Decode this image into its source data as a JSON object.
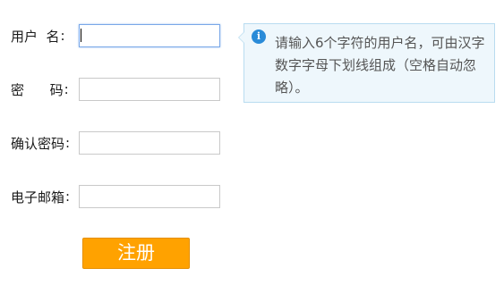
{
  "form": {
    "username": {
      "label": "用户  名",
      "colon": ":",
      "value": ""
    },
    "password": {
      "label": "密      码",
      "colon": ":",
      "value": ""
    },
    "confirm_password": {
      "label": "确认密码",
      "colon": ":",
      "value": ""
    },
    "email": {
      "label": "电子邮箱",
      "colon": ":",
      "value": ""
    },
    "tip": {
      "icon": "info-icon",
      "icon_glyph": "i",
      "text": "请输入6个字符的用户名，可由汉字数字字母下划线组成（空格自动忽略）。"
    },
    "submit_label": "注册"
  },
  "colors": {
    "submit_bg": "#ffa200",
    "tip_bg": "#eef7fc",
    "tip_border": "#b9dcf0",
    "info_icon": "#2a8bd8",
    "focus_border": "#7aa8e8"
  }
}
